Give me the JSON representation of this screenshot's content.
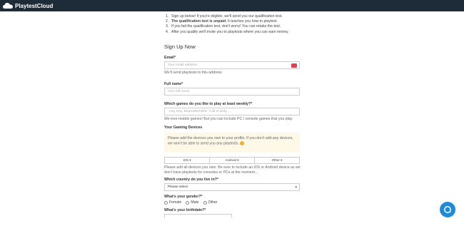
{
  "brand": {
    "name": "PlaytestCloud"
  },
  "steps": [
    {
      "num": "1.",
      "text": "Sign up below! If you're eligible, we'll send you our qualification test."
    },
    {
      "num": "2.",
      "bold": "The qualification test is unpaid.",
      "text": " It teaches you how to playtest."
    },
    {
      "num": "3.",
      "text": "If you fail the qualification test, don't worry! You can retake the test."
    },
    {
      "num": "4.",
      "text": "After you qualify we'll invite you to playtests where you can earn money."
    }
  ],
  "form": {
    "title": "Sign Up Now",
    "email": {
      "label": "Email*",
      "placeholder": "Your email address",
      "help": "We'll send playtests to this address"
    },
    "name": {
      "label": "Full name*",
      "placeholder": "Your full name"
    },
    "games": {
      "label": "Which games do you like to play at least weekly?*",
      "placeholder": "Hay Day, Bejeweled Blitz, Call of Duty, ...",
      "help": "We love mobile games! But you can include PC / console games that you play."
    },
    "devices": {
      "label": "Your Gaming Devices",
      "notice": "Please add the devices you own to your profile. If you don't add any devices, we won't be able to send you any playtests.",
      "buttons": [
        "iOS ▾",
        "Android ▾",
        "Other ▾"
      ],
      "help": "Please add all devices you own. Be sure to include an iOS or Android device as we don't have playtests for consoles or PCs at the moment..."
    },
    "country": {
      "label": "Which country do you live in?*",
      "selected": "Please select"
    },
    "gender": {
      "label": "What's your gender?*",
      "options": [
        "Female",
        "Male",
        "Other"
      ]
    },
    "birthdate": {
      "label": "What's your birthdate?*"
    }
  },
  "colors": {
    "topbar": "#1e2b38",
    "chat_button": "#1f8ad8",
    "notice_bg": "#fdf8e8",
    "badge": "#e04050"
  },
  "icons": {
    "logo": "cloud-logo-icon",
    "chat": "chat-bubble-icon",
    "caret": "chevron-down-icon"
  }
}
